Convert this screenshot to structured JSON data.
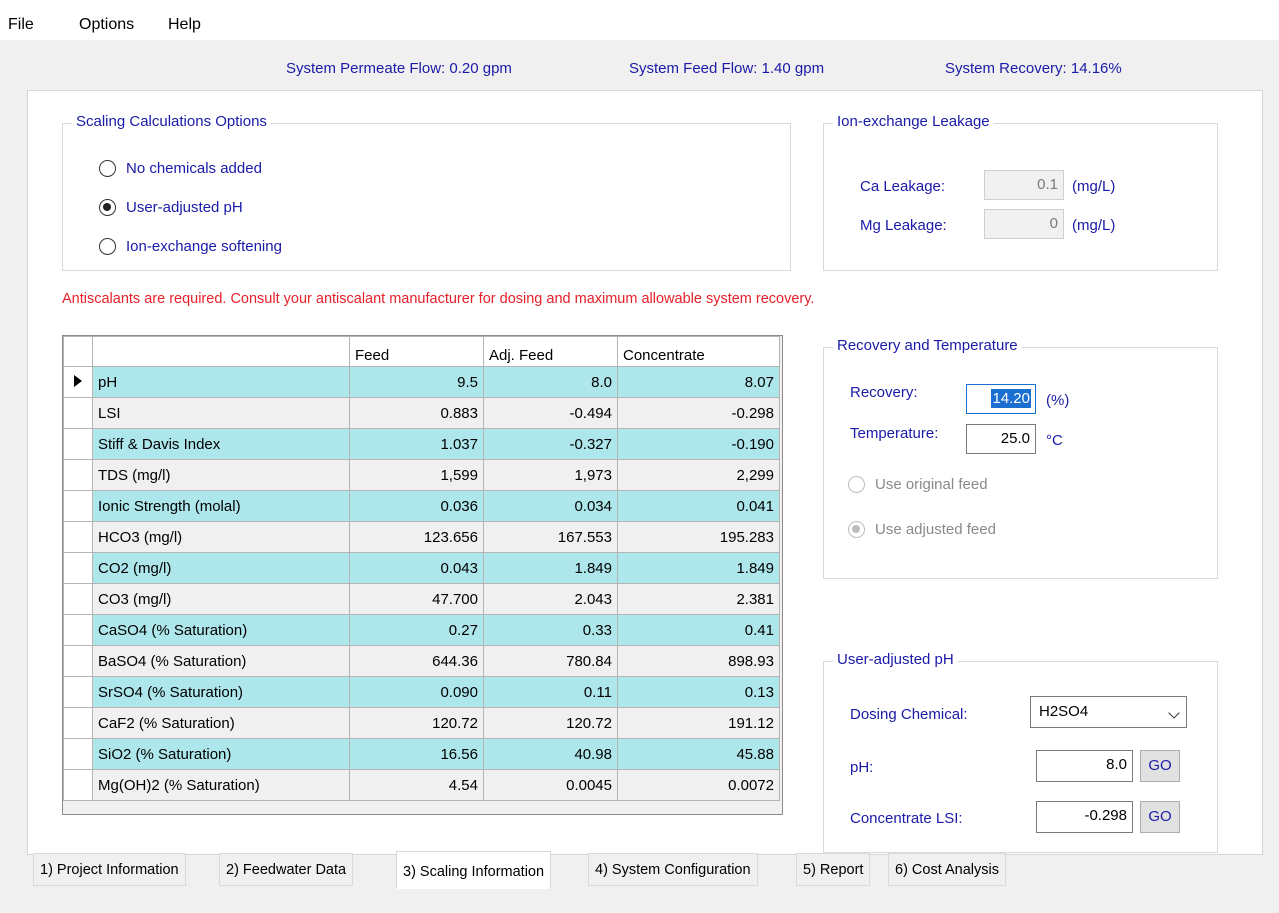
{
  "menu": {
    "file": "File",
    "options": "Options",
    "help": "Help"
  },
  "status": {
    "permeate_flow": "System Permeate Flow:  0.20 gpm",
    "feed_flow": "System Feed Flow:  1.40 gpm",
    "recovery": "System Recovery:   14.16%"
  },
  "scaling_options": {
    "title": "Scaling Calculations Options",
    "opt_none": "No chemicals added",
    "opt_user_ph": "User-adjusted pH",
    "opt_ion_exchange": "Ion-exchange softening",
    "selected": "User-adjusted pH"
  },
  "ion_exchange": {
    "title": "Ion-exchange Leakage",
    "ca_label": "Ca Leakage:",
    "ca_value": "0.1",
    "ca_unit": "(mg/L)",
    "mg_label": "Mg Leakage:",
    "mg_value": "0",
    "mg_unit": "(mg/L)"
  },
  "warning": "Antiscalants are required. Consult your antiscalant manufacturer for dosing and maximum allowable system recovery.",
  "table": {
    "headers": [
      "",
      "Feed",
      "Adj. Feed",
      "Concentrate"
    ],
    "rows": [
      [
        "pH",
        "9.5",
        "8.0",
        "8.07"
      ],
      [
        "LSI",
        "0.883",
        "-0.494",
        "-0.298"
      ],
      [
        "Stiff & Davis Index",
        "1.037",
        "-0.327",
        "-0.190"
      ],
      [
        "TDS (mg/l)",
        "1,599",
        "1,973",
        "2,299"
      ],
      [
        "Ionic Strength (molal)",
        "0.036",
        "0.034",
        "0.041"
      ],
      [
        "HCO3 (mg/l)",
        "123.656",
        "167.553",
        "195.283"
      ],
      [
        "CO2 (mg/l)",
        "0.043",
        "1.849",
        "1.849"
      ],
      [
        "CO3 (mg/l)",
        "47.700",
        "2.043",
        "2.381"
      ],
      [
        "CaSO4 (% Saturation)",
        "0.27",
        "0.33",
        "0.41"
      ],
      [
        "BaSO4 (% Saturation)",
        "644.36",
        "780.84",
        "898.93"
      ],
      [
        "SrSO4 (% Saturation)",
        "0.090",
        "0.11",
        "0.13"
      ],
      [
        "CaF2 (% Saturation)",
        "120.72",
        "120.72",
        "191.12"
      ],
      [
        "SiO2 (% Saturation)",
        "16.56",
        "40.98",
        "45.88"
      ],
      [
        "Mg(OH)2 (% Saturation)",
        "4.54",
        "0.0045",
        "0.0072"
      ]
    ]
  },
  "recovery_temp": {
    "title": "Recovery and Temperature",
    "recovery_label": "Recovery:",
    "recovery_value": "14.20",
    "recovery_unit": "(%)",
    "temp_label": "Temperature:",
    "temp_value": "25.0",
    "temp_unit": "°C",
    "opt_original": "Use original feed",
    "opt_adjusted": "Use adjusted feed"
  },
  "user_ph": {
    "title": "User-adjusted pH",
    "dosing_label": "Dosing Chemical:",
    "dosing_value": "H2SO4",
    "ph_label": "pH:",
    "ph_value": "8.0",
    "lsi_label": "Concentrate LSI:",
    "lsi_value": "-0.298",
    "go_label": "GO"
  },
  "tabs": [
    "1) Project Information",
    "2) Feedwater Data",
    "3) Scaling Information",
    "4) System Configuration",
    "5) Report",
    "6) Cost Analysis"
  ],
  "colors": {
    "label_blue": "#1a1aa8",
    "row_highlight": "#aee7eb",
    "warning_red": "#e8202a"
  }
}
